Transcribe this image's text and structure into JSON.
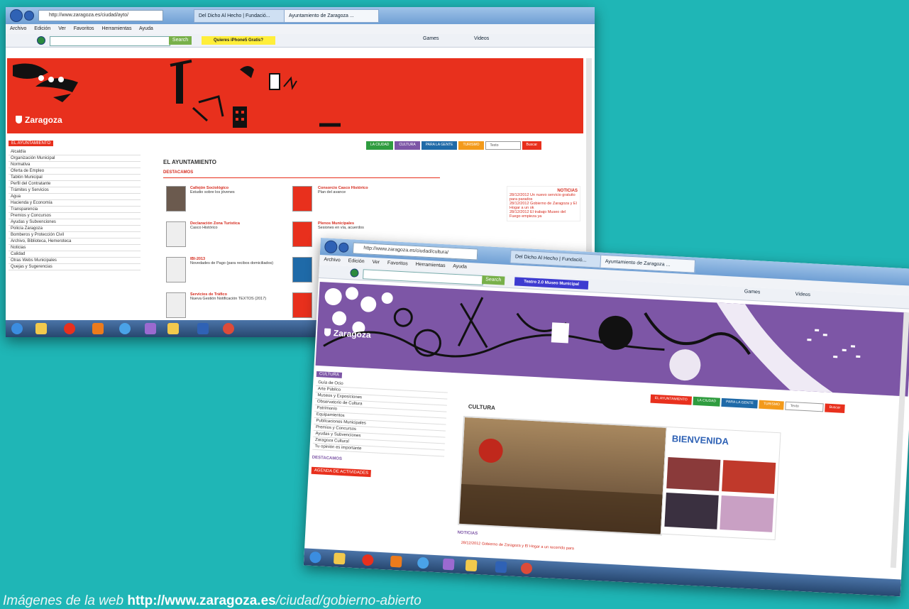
{
  "screen1": {
    "tabs": [
      "Del Dicho Al Hecho | Fundació...",
      "Ayuntamiento de Zaragoza ..."
    ],
    "address": "http://www.zaragoza.es/ciudad/ayto/",
    "menu": [
      "Archivo",
      "Edición",
      "Ver",
      "Favoritos",
      "Herramientas",
      "Ayuda"
    ],
    "search_btn": "Search",
    "promo": "Quieres iPhone5 Gratis?",
    "toolbar_right": [
      "Games",
      "Videos"
    ],
    "logo": "Zaragoza",
    "breadcrumb_btn": "EL AYUNTAMIENTO",
    "nav_tabs": [
      "LA CIUDAD",
      "CULTURA",
      "PARA LA GENTE",
      "TURISMO"
    ],
    "search_placeholder": "Texto",
    "search_go": "Buscar",
    "side_menu": [
      "Alcaldía",
      "Organización Municipal",
      "Normativa",
      "Oferta de Empleo",
      "Tablón Municipal",
      "Perfil del Contratante",
      "Trámites y Servicios",
      "Agua",
      "Hacienda y Economía",
      "Transparencia",
      "Premios y Concursos",
      "Ayudas y Subvenciones",
      "Policía Zaragoza",
      "Bomberos y Protección Civil",
      "Archivo, Biblioteca, Hemeroteca",
      "Noticias",
      "Calidad",
      "Otras Webs Municipales",
      "Quejas y Sugerencias"
    ],
    "section_title": "EL AYUNTAMIENTO",
    "destacamos": "DESTACAMOS",
    "features": [
      {
        "title": "Callejón Sociológico",
        "text": "Estudio sobre los jóvenes"
      },
      {
        "title": "Consorcio Casco Histórico",
        "text": "Plan del avance"
      },
      {
        "title": "Declaración Zona Turística",
        "text": "Casco Histórico"
      },
      {
        "title": "Plenos Municipales",
        "text": "Sesiones en vía, acuerdos"
      },
      {
        "title": "IBI-2013",
        "text": "Novedades de Pago (para recibos domiciliados)"
      },
      {
        "title": "Servicios de Tráfico",
        "text": "Nueva Gestión Notificación TEXTOS (2017)"
      }
    ],
    "news_title": "NOTICIAS",
    "news": [
      "28/12/2012 Un nuevo servicio gratuito para parados",
      "28/12/2012 Gobierno de Zaragoza y El Hogar a un ok",
      "28/12/2012 El trabajo Museo del Fuego empieza ya"
    ]
  },
  "screen2": {
    "tabs": [
      "Del Dicho Al Hecho | Fundació...",
      "Ayuntamiento de Zaragoza ..."
    ],
    "address": "http://www.zaragoza.es/ciudad/cultura/",
    "menu": [
      "Archivo",
      "Edición",
      "Ver",
      "Favoritos",
      "Herramientas",
      "Ayuda"
    ],
    "search_btn": "Search",
    "promo": "Teatro 2.0 Museo Municipal",
    "toolbar_right": [
      "Games",
      "Videos"
    ],
    "logo": "Zaragoza",
    "breadcrumb_btn": "CULTURA",
    "nav_tabs": [
      "EL AYUNTAMIENTO",
      "LA CIUDAD",
      "PARA LA GENTE",
      "TURISMO"
    ],
    "search_placeholder": "Texto",
    "search_go": "Buscar",
    "side_menu": [
      "Guía de Ocio",
      "Arte Público",
      "Museos y Exposiciones",
      "Observatorio de Cultura",
      "Patrimonio",
      "Equipamientos",
      "Publicaciones Municipales",
      "Premios y Concursos",
      "Ayudas y Subvenciones",
      "Zaragoza Cultural",
      "Tu opinión es importante"
    ],
    "destacamos": "DESTACAMOS",
    "agenda_btn": "AGENDA DE ACTIVIDADES",
    "section_title": "CULTURA",
    "bienvenida": "BIENVENIDA",
    "noticias": "NOTICIAS",
    "news_item": "28/12/2012 Gobierno de Zaragoza y El Hogar a un recorrido para"
  },
  "caption": {
    "prefix": "Imágenes de la web ",
    "url": "http://www.zaragoza.es",
    "suffix": "/ciudad/gobierno-abierto"
  },
  "colors": {
    "zaragoza_red": "#e8301d",
    "cultura_purple": "#7d56a6",
    "background": "#1fb6b6",
    "tab_green": "#2f9c3f",
    "tab_blue": "#1f6aa8",
    "tab_orange": "#f39a1b"
  }
}
